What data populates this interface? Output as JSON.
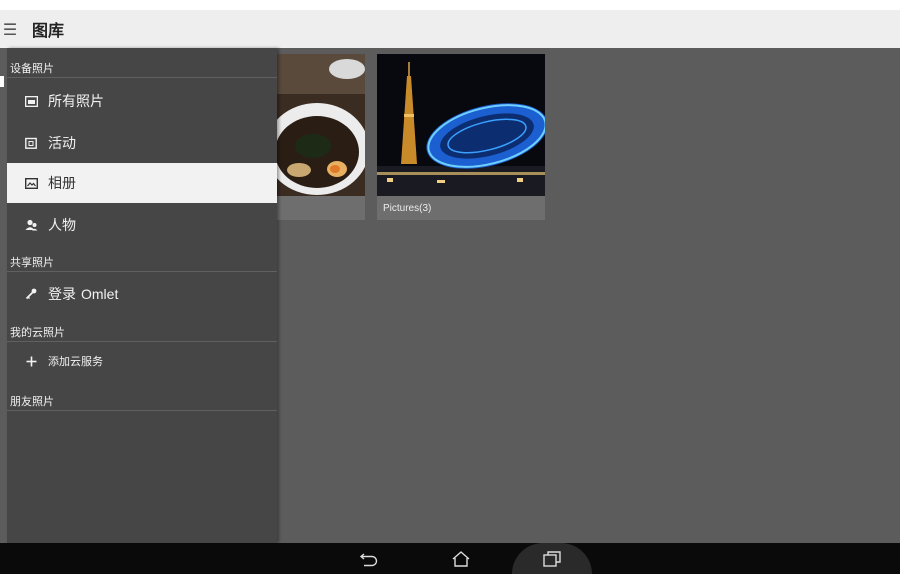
{
  "appbar": {
    "title": "图库",
    "menu_glyph": "☰"
  },
  "drawer": {
    "sections": [
      {
        "header": "设备照片"
      },
      {
        "header": "共享照片"
      },
      {
        "header": "我的云照片"
      },
      {
        "header": "朋友照片"
      }
    ],
    "items": {
      "all_photos": {
        "label": "所有照片",
        "icon": "photos-icon"
      },
      "events": {
        "label": "活动",
        "icon": "calendar-icon"
      },
      "albums": {
        "label": "相册",
        "icon": "album-icon",
        "selected": true
      },
      "people": {
        "label": "人物",
        "icon": "people-icon"
      },
      "login_omlet": {
        "label_prefix": "登录",
        "label_suffix": "Omlet",
        "icon": "key-icon"
      },
      "add_cloud": {
        "label": "添加云服务",
        "icon": "plus-icon"
      }
    }
  },
  "albums": [
    {
      "caption": ""
    },
    {
      "caption": "Pictures(3)"
    }
  ],
  "navbar": {
    "buttons": [
      "back",
      "home",
      "recent-apps"
    ]
  },
  "colors": {
    "drawer_bg": "#464646",
    "selected_bg": "#f2f2f2",
    "content_bg": "#5c5c5c",
    "appbar_bg": "#eeeeee"
  }
}
